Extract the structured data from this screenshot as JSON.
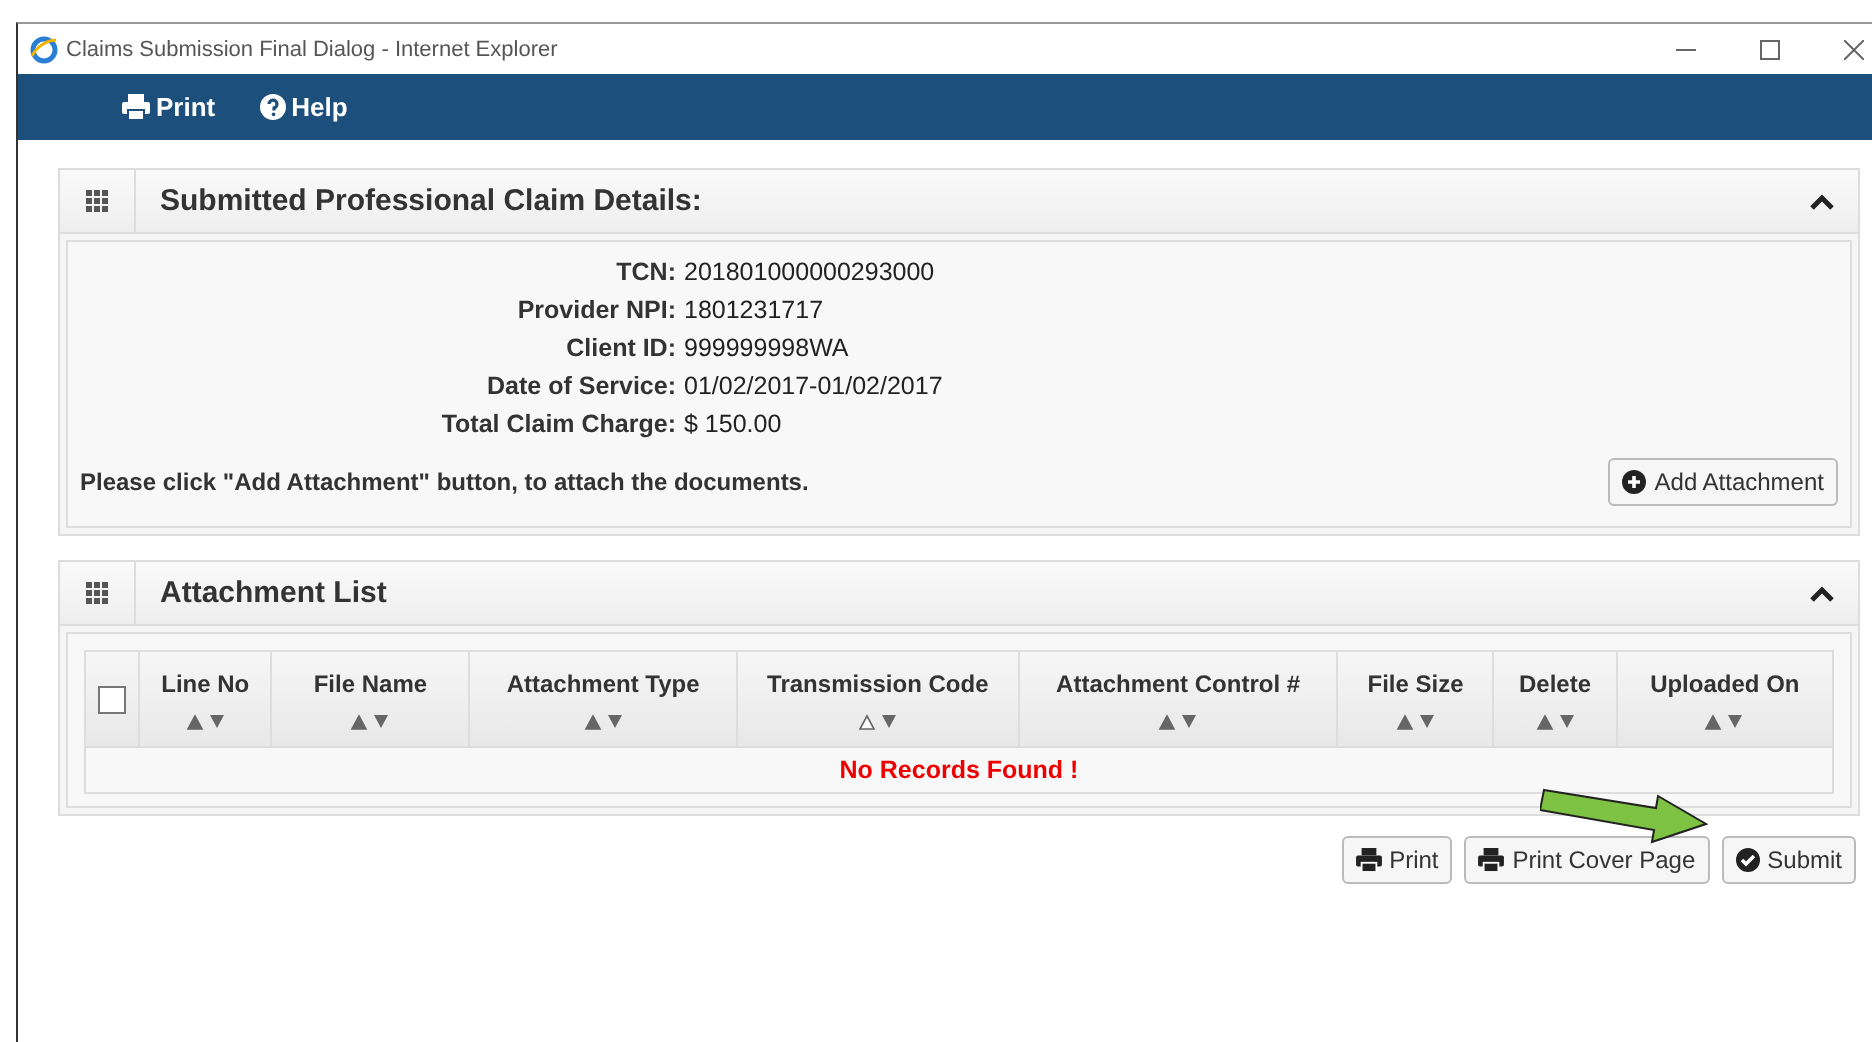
{
  "window": {
    "title": "Claims Submission Final Dialog - Internet Explorer"
  },
  "toolbar": [
    {
      "kind": "print",
      "label": "Print"
    },
    {
      "kind": "help",
      "label": "Help"
    }
  ],
  "claim_panel": {
    "title": "Submitted Professional Claim Details:",
    "expanded": true,
    "fields": [
      {
        "label": "TCN:",
        "value": "201801000000293000"
      },
      {
        "label": "Provider NPI:",
        "value": "1801231717"
      },
      {
        "label": "Client ID:",
        "value": "999999998WA"
      },
      {
        "label": "Date of Service:",
        "value": "01/02/2017-01/02/2017"
      },
      {
        "label": "Total Claim Charge:",
        "value": "$ 150.00"
      }
    ],
    "instruction": "Please click \"Add Attachment\" button, to attach the documents.",
    "add_button": "Add Attachment"
  },
  "attachment_panel": {
    "title": "Attachment List",
    "expanded": true,
    "select_all_checked": false,
    "columns": [
      {
        "label": "Line No",
        "sorted": false
      },
      {
        "label": "File Name",
        "sorted": false
      },
      {
        "label": "Attachment Type",
        "sorted": false
      },
      {
        "label": "Transmission Code",
        "sorted": true
      },
      {
        "label": "Attachment Control #",
        "sorted": false
      },
      {
        "label": "File Size",
        "sorted": false
      },
      {
        "label": "Delete",
        "sorted": false
      },
      {
        "label": "Uploaded On",
        "sorted": false
      }
    ],
    "empty_message": "No Records Found !"
  },
  "buttons": [
    {
      "kind": "print",
      "label": "Print"
    },
    {
      "kind": "print",
      "label": "Print Cover Page"
    },
    {
      "kind": "submit",
      "label": "Submit"
    }
  ]
}
